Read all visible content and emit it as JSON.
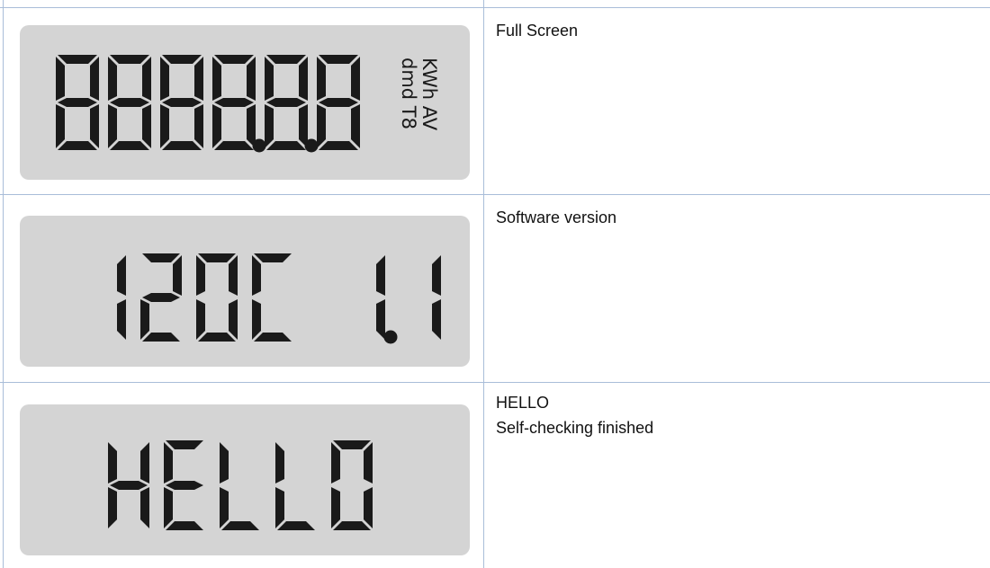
{
  "rows": [
    {
      "display_text": "8888.8.8",
      "units": [
        "KWh AV",
        "dmd T8"
      ],
      "description": [
        "Full Screen"
      ]
    },
    {
      "display_text": "120C 1.1",
      "units": [],
      "description": [
        "Software version"
      ]
    },
    {
      "display_text": "HELLO",
      "units": [],
      "description": [
        "HELLO",
        "Self-checking finished"
      ]
    }
  ],
  "colors": {
    "lcd_background": "#d4d4d4",
    "segment": "#1a1a1a",
    "grid_line": "#a9bdd9",
    "text": "#111111"
  }
}
